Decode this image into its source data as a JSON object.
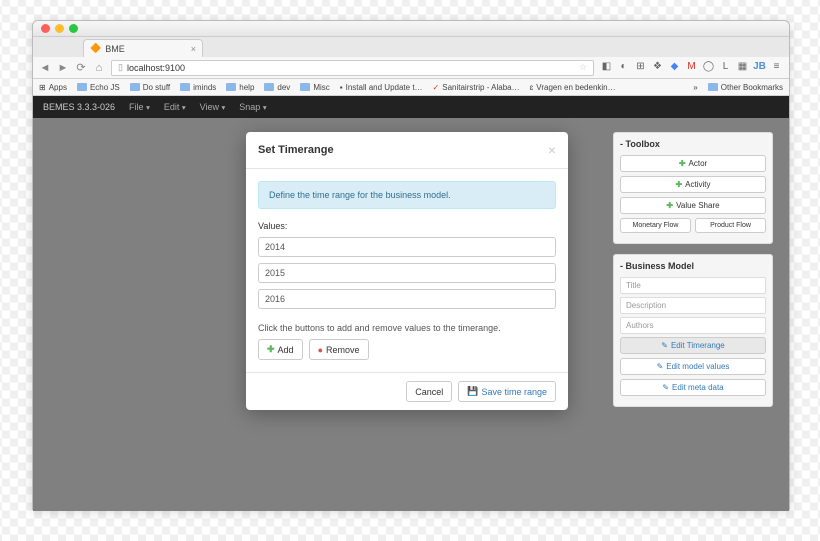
{
  "browser": {
    "tab_title": "BME",
    "url": "localhost:9100",
    "bookmarks": [
      "Apps",
      "Echo JS",
      "Do stuff",
      "iminds",
      "help",
      "dev",
      "Misc",
      "Install and Update t…",
      "Sanitairstrip - Alaba…",
      "Vragen en bedenkin…"
    ],
    "other_bookmarks": "Other Bookmarks"
  },
  "app": {
    "brand": "BEMES 3.3.3-026",
    "menu": [
      "File",
      "Edit",
      "View",
      "Snap"
    ]
  },
  "modal": {
    "title": "Set Timerange",
    "info": "Define the time range for the business model.",
    "values_label": "Values:",
    "values": [
      "2014",
      "2015",
      "2016"
    ],
    "hint": "Click the buttons to add and remove values to the timerange.",
    "add": "Add",
    "remove": "Remove",
    "cancel": "Cancel",
    "save": "Save time range"
  },
  "toolbox": {
    "title": "Toolbox",
    "actor": "Actor",
    "activity": "Activity",
    "value_share": "Value Share",
    "monetary": "Monetary Flow",
    "product": "Product Flow"
  },
  "bm": {
    "title": "Business Model",
    "fields": {
      "title": "Title",
      "desc": "Description",
      "authors": "Authors"
    },
    "edit_timerange": "Edit Timerange",
    "edit_values": "Edit model values",
    "edit_meta": "Edit meta data"
  }
}
